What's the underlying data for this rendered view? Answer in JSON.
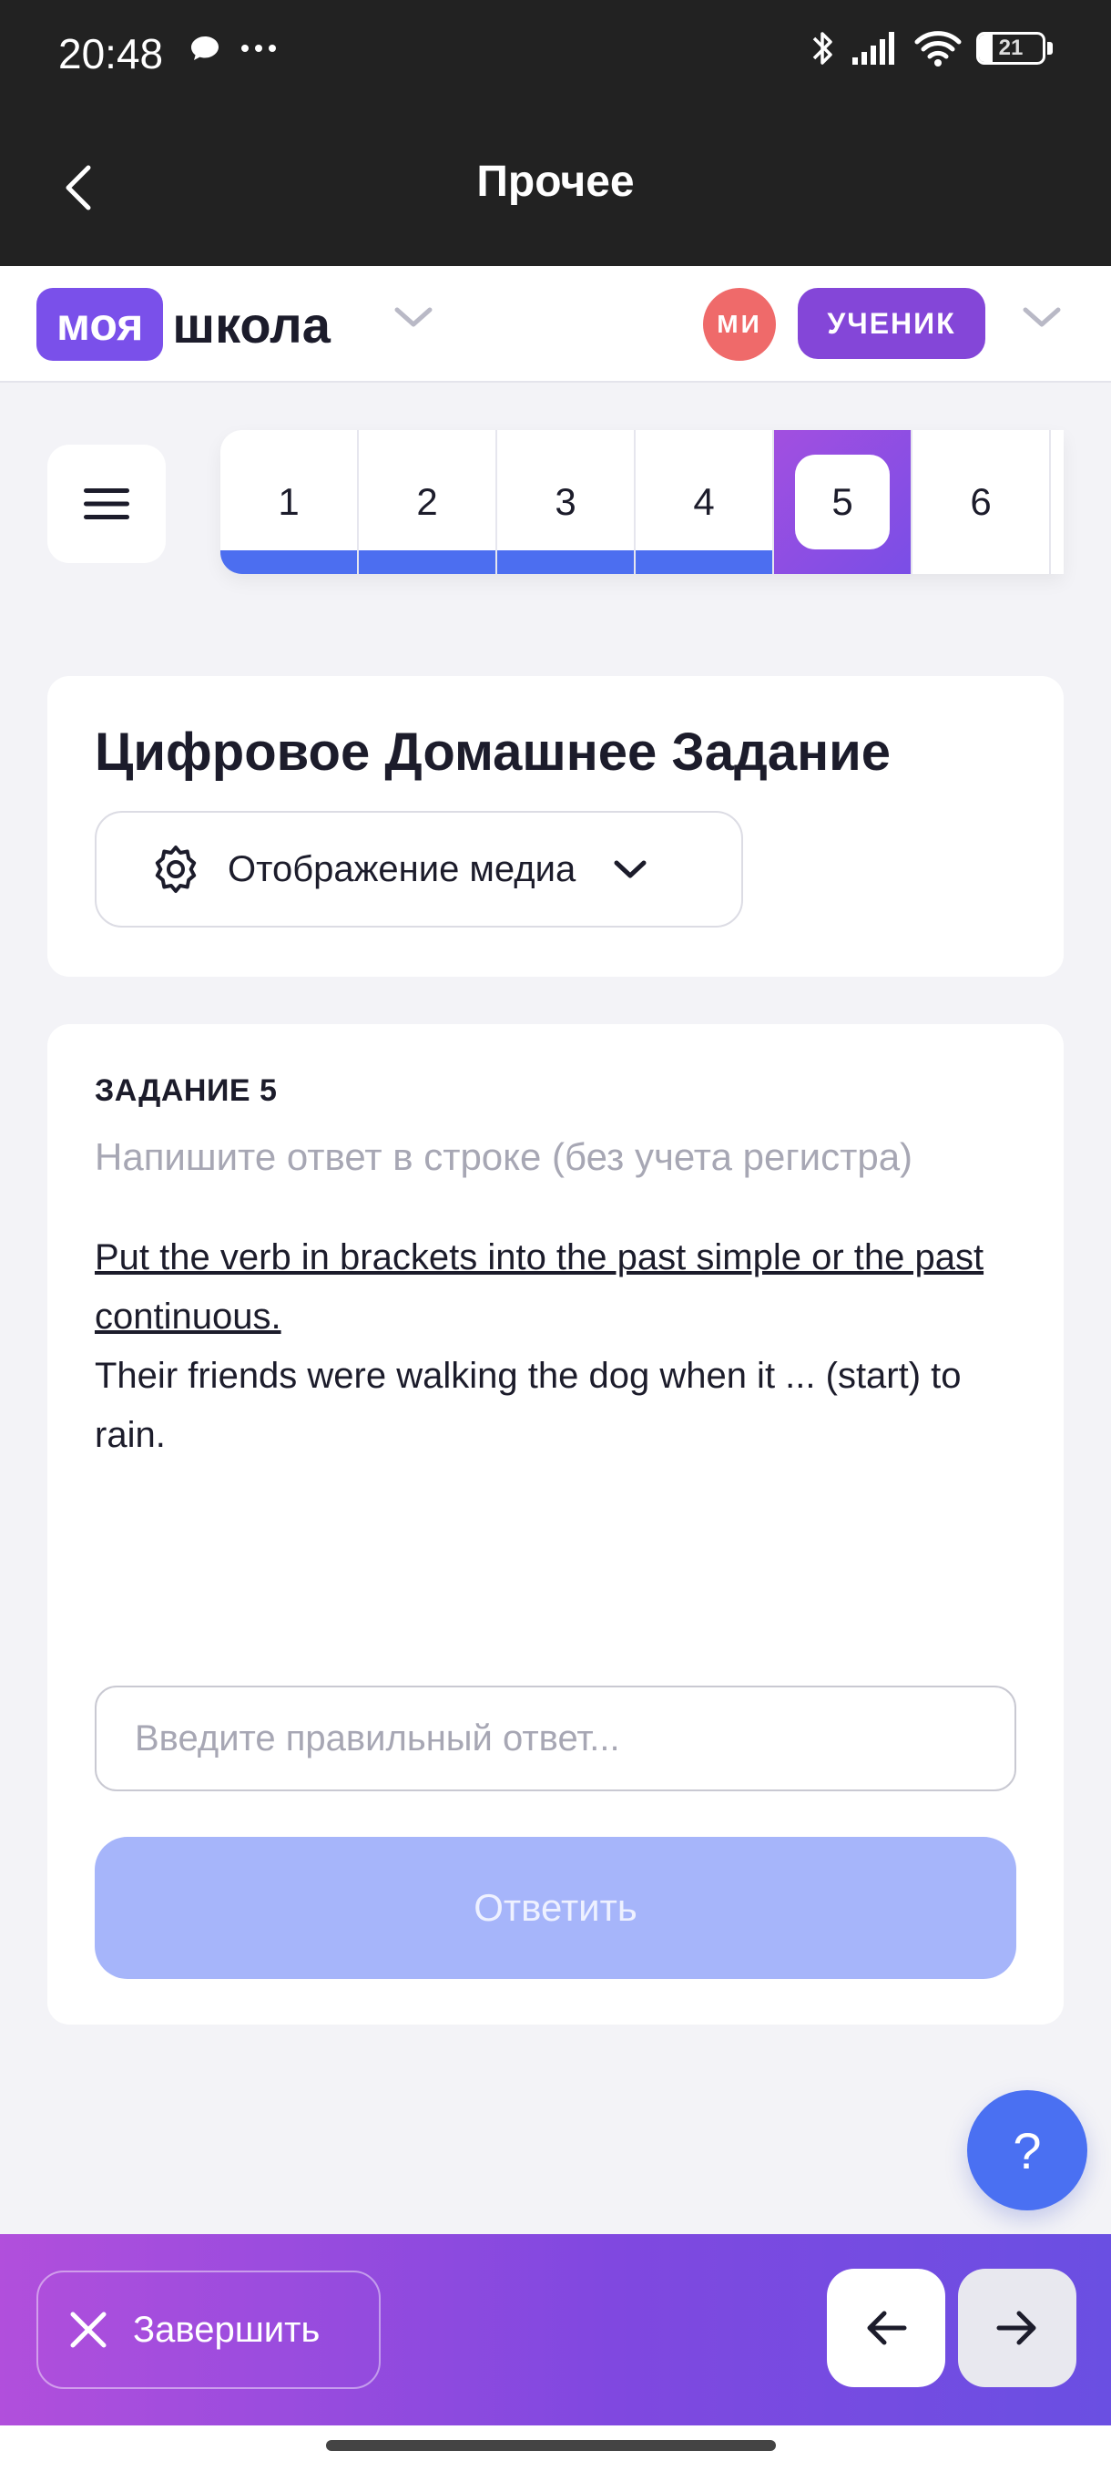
{
  "status_bar": {
    "time": "20:48",
    "battery": "21",
    "battery_level": 0.21
  },
  "app_bar": {
    "title": "Прочее"
  },
  "header": {
    "logo_badge": "моя",
    "logo_text": "школа",
    "avatar_initials": "МИ",
    "role": "УЧЕНИК"
  },
  "task_nav": {
    "tabs": [
      {
        "label": "1",
        "state": "done"
      },
      {
        "label": "2",
        "state": "done"
      },
      {
        "label": "3",
        "state": "done"
      },
      {
        "label": "4",
        "state": "done"
      },
      {
        "label": "5",
        "state": "active"
      },
      {
        "label": "6",
        "state": "pending"
      }
    ]
  },
  "assignment": {
    "title": "Цифровое Домашнее Задание",
    "media_toggle": "Отображение медиа"
  },
  "task": {
    "label": "ЗАДАНИЕ 5",
    "hint": "Напишите ответ в строке (без учета регистра)",
    "instruction": "Put the verb in brackets into the past simple or the past continuous.",
    "sentence": "Their friends were walking the dog when it ... (start) to rain.",
    "input_value": "",
    "input_placeholder": "Введите правильный ответ...",
    "submit_label": "Ответить"
  },
  "help": {
    "label": "?"
  },
  "bottom_bar": {
    "finish_label": "Завершить"
  },
  "colors": {
    "accent": "#7a50ea",
    "progress": "#4c6ef0",
    "submit_disabled": "#a6b5fa",
    "avatar": "#ef6a6a",
    "help": "#4a70f2"
  }
}
